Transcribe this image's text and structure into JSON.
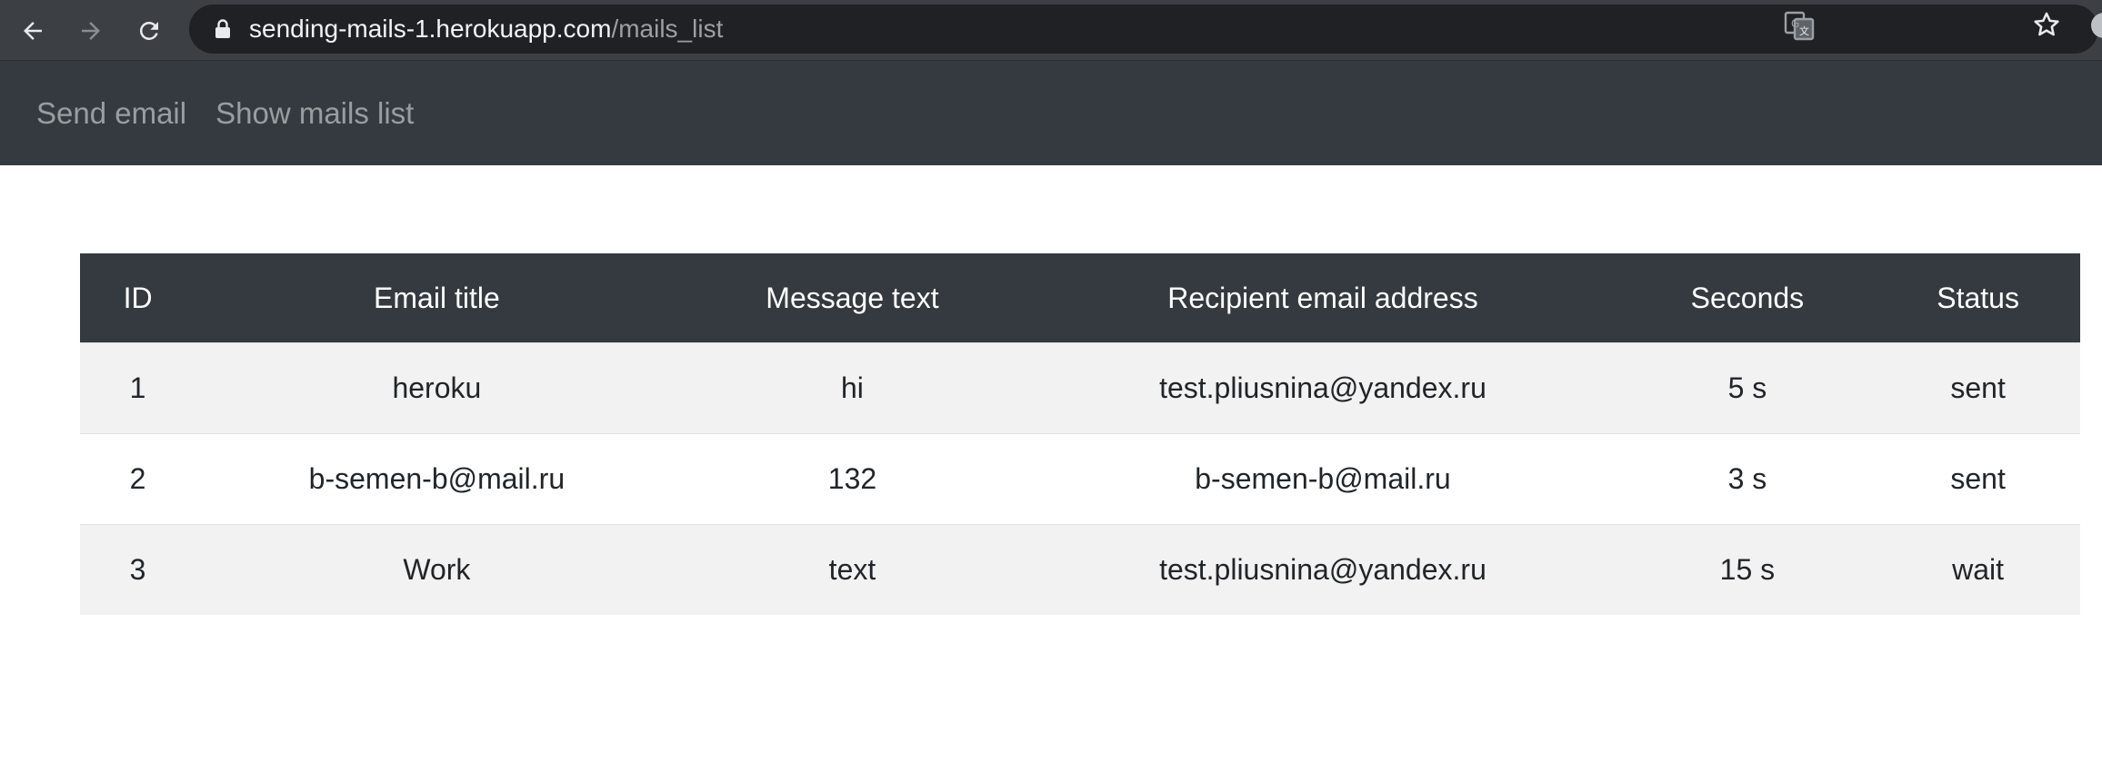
{
  "browser": {
    "url_host": "sending-mails-1.herokuapp.com",
    "url_path": "/mails_list",
    "icons": [
      "back-arrow-icon",
      "forward-arrow-icon",
      "reload-icon",
      "lock-icon",
      "translate-icon",
      "star-icon"
    ]
  },
  "navbar": {
    "links": [
      {
        "label": "Send email"
      },
      {
        "label": "Show mails list"
      }
    ],
    "background": "#343a40"
  },
  "table": {
    "columns": [
      "ID",
      "Email title",
      "Message text",
      "Recipient email address",
      "Seconds",
      "Status"
    ],
    "rows": [
      {
        "id": "1",
        "title": "heroku",
        "message": "hi",
        "recipient": "test.pliusnina@yandex.ru",
        "seconds": "5 s",
        "status": "sent"
      },
      {
        "id": "2",
        "title": "b-semen-b@mail.ru",
        "message": "132",
        "recipient": "b-semen-b@mail.ru",
        "seconds": "3 s",
        "status": "sent"
      },
      {
        "id": "3",
        "title": "Work",
        "message": "text",
        "recipient": "test.pliusnina@yandex.ru",
        "seconds": "15 s",
        "status": "wait"
      }
    ],
    "header_background": "#343a40",
    "stripe_color": "#f2f2f2"
  }
}
